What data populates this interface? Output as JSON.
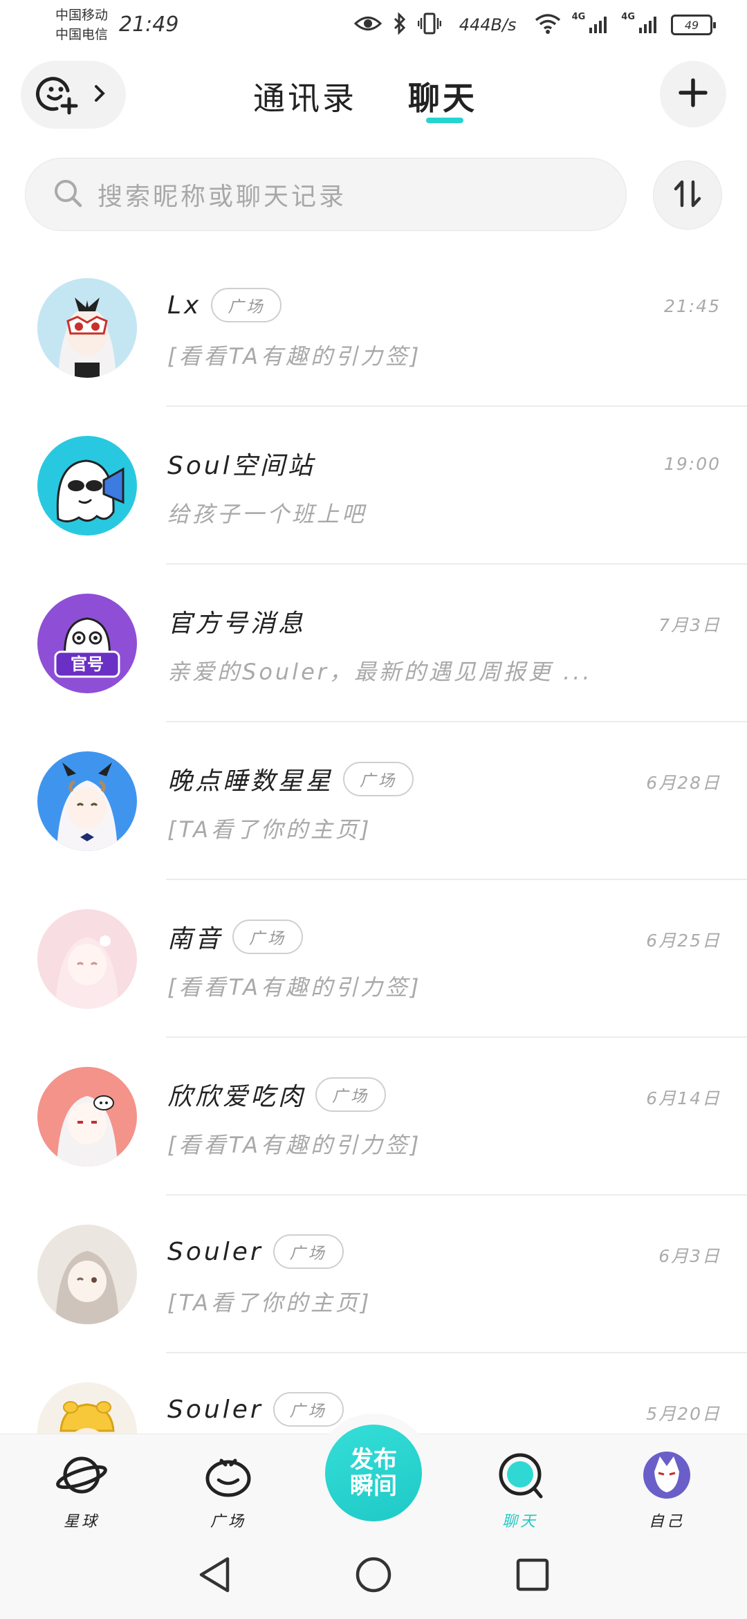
{
  "status_bar": {
    "carrier_1": "中国移动",
    "carrier_2": "中国电信",
    "time": "21:49",
    "net_speed": "444B/s",
    "signal_1_label": "4G",
    "signal_2_label": "4G",
    "battery": "49"
  },
  "header": {
    "tab_contacts": "通讯录",
    "tab_chat": "聊天",
    "active_tab": "聊天"
  },
  "search": {
    "placeholder": "搜索昵称或聊天记录"
  },
  "chats": [
    {
      "name": "Lx",
      "tag": "广场",
      "time": "21:45",
      "preview": "[看看TA有趣的引力签]",
      "avatar": "anime-fox-mask-avatar"
    },
    {
      "name": "Soul空间站",
      "tag": "",
      "time": "19:00",
      "preview": "给孩子一个班上吧",
      "avatar": "ghost-megaphone-avatar"
    },
    {
      "name": "官方号消息",
      "tag": "",
      "time": "7月3日",
      "preview": "亲爱的Souler，最新的遇见周报更 ...",
      "avatar": "official-ghost-avatar",
      "avatar_badge": "官号"
    },
    {
      "name": "晚点睡数星星",
      "tag": "广场",
      "time": "6月28日",
      "preview": "[TA看了你的主页]",
      "avatar": "anime-horned-girl-avatar"
    },
    {
      "name": "南音",
      "tag": "广场",
      "time": "6月25日",
      "preview": "[看看TA有趣的引力签]",
      "avatar": "anime-pink-girl-avatar"
    },
    {
      "name": "欣欣爱吃肉",
      "tag": "广场",
      "time": "6月14日",
      "preview": "[看看TA有趣的引力签]",
      "avatar": "anime-white-hair-girl-avatar"
    },
    {
      "name": "Souler",
      "tag": "广场",
      "time": "6月3日",
      "preview": "[TA看了你的主页]",
      "avatar": "anime-beige-girl-avatar"
    },
    {
      "name": "Souler",
      "tag": "广场",
      "time": "5月20日",
      "preview": "",
      "avatar": "yellow-cow-hat-avatar"
    }
  ],
  "bottom_nav": {
    "planet": "星球",
    "square": "广场",
    "publish_line1": "发布",
    "publish_line2": "瞬间",
    "chat": "聊天",
    "me": "自己"
  },
  "colors": {
    "accent": "#25d4d0",
    "text_primary": "#222222",
    "text_secondary": "#a9a9a9"
  }
}
